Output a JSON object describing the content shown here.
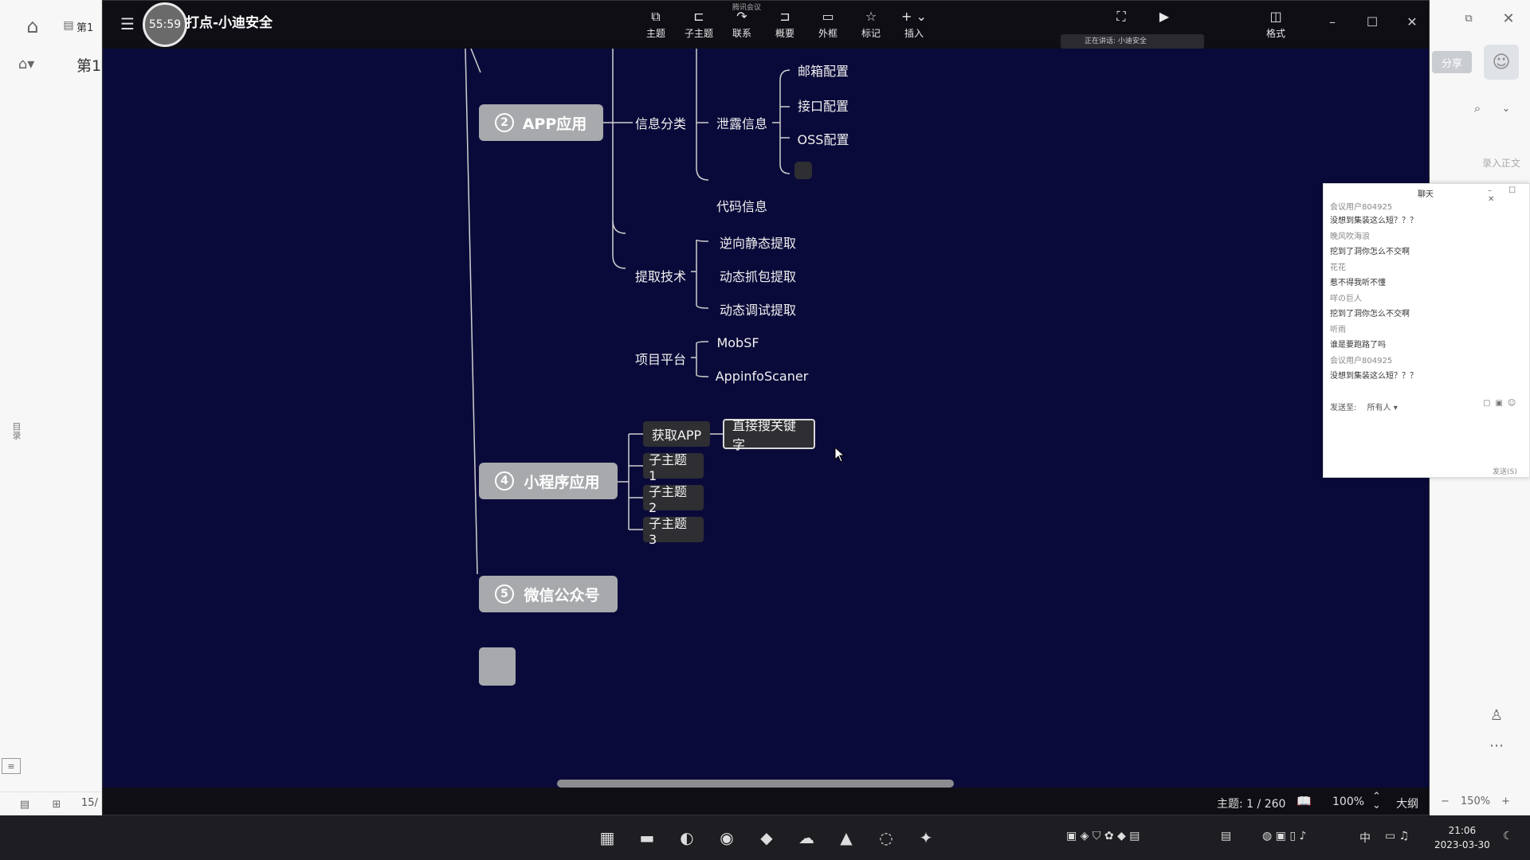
{
  "background_app": {
    "tab_label": "第1",
    "page_label": "第1",
    "share_label": "分享",
    "hint": "录入正文",
    "vertical_text": "目录",
    "page_count": "15/"
  },
  "window": {
    "timer": "55:59",
    "title": "打点-小迪安全",
    "meeting_label": "腾讯会议",
    "toolbar": [
      {
        "label": "主题",
        "icon": "topic-icon"
      },
      {
        "label": "子主题",
        "icon": "subtopic-icon"
      },
      {
        "label": "联系",
        "icon": "relation-icon"
      },
      {
        "label": "概要",
        "icon": "summary-icon"
      },
      {
        "label": "外框",
        "icon": "boundary-icon"
      },
      {
        "label": "标记",
        "icon": "star-icon"
      },
      {
        "label": "插入",
        "icon": "plus-icon"
      },
      {
        "label": "格式",
        "icon": "format-panel-icon"
      }
    ],
    "speaking": "正在讲话: 小迪安全"
  },
  "mindmap": {
    "main_topics": [
      {
        "num": "2",
        "label": "APP应用"
      },
      {
        "num": "4",
        "label": "小程序应用"
      },
      {
        "num": "5",
        "label": "微信公众号"
      }
    ],
    "app": {
      "info_classify": "信息分类",
      "leak_info": "泄露信息",
      "mail_config": "邮箱配置",
      "api_config": "接口配置",
      "oss_config": "OSS配置",
      "code_info": "代码信息",
      "extract_tech": "提取技术",
      "reverse_static": "逆向静态提取",
      "dynamic_capture": "动态抓包提取",
      "dynamic_debug": "动态调试提取",
      "project_platform": "项目平台",
      "mobsf": "MobSF",
      "appinfoscanner": "AppinfoScaner"
    },
    "miniprogram": {
      "get_app": "获取APP",
      "search_keyword": "直接搜关键字",
      "sub1": "子主题 1",
      "sub2": "子主题 2",
      "sub3": "子主题 3"
    }
  },
  "statusbar": {
    "topic_count": "主题: 1 / 260",
    "zoom": "100%",
    "outline": "大纲"
  },
  "chat": {
    "title": "聊天",
    "messages": [
      {
        "name": "会议用户804925",
        "text": "没想到集装这么短？？？"
      },
      {
        "name": "晚风吹海浪",
        "text": "挖到了洞你怎么不交啊"
      },
      {
        "name": "花花",
        "text": "惹不得我听不懂"
      },
      {
        "name": "咩の巨人",
        "text": "挖到了洞你怎么不交啊"
      },
      {
        "name": "听雨",
        "text": "谁是要跑路了吗"
      },
      {
        "name": "会议用户804925",
        "text": "没想到集装这么短？？？"
      }
    ],
    "send_to": "发送至:",
    "send_to_value": "所有人",
    "send_label": "发送(S)"
  },
  "taskbar": {
    "time": "21:06",
    "date": "2023-03-30",
    "ime": "中"
  },
  "background_zoom": "150%",
  "colors": {
    "canvas_bg": "#0a0a3a",
    "main_topic_bg": "#a7a9ac",
    "subtopic_bg": "#2e2e33",
    "branch_line": "#d0d0d0"
  }
}
